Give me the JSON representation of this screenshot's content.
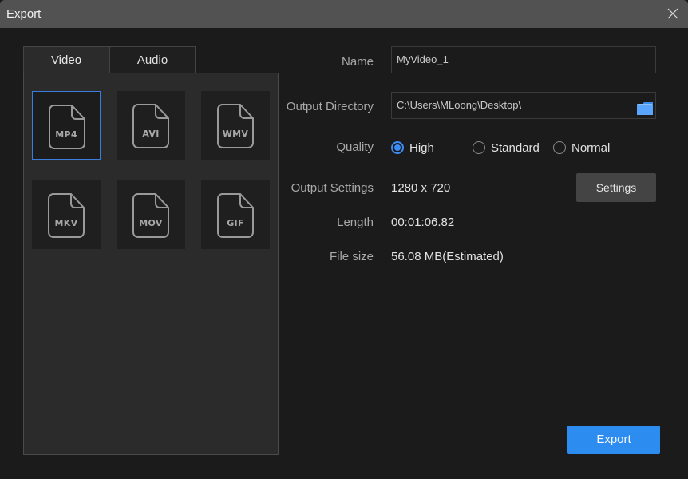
{
  "window": {
    "title": "Export"
  },
  "tabs": [
    {
      "label": "Video",
      "active": true
    },
    {
      "label": "Audio",
      "active": false
    }
  ],
  "formats": [
    {
      "label": "MP4",
      "selected": true
    },
    {
      "label": "AVI",
      "selected": false
    },
    {
      "label": "WMV",
      "selected": false
    },
    {
      "label": "MKV",
      "selected": false
    },
    {
      "label": "MOV",
      "selected": false
    },
    {
      "label": "GIF",
      "selected": false
    }
  ],
  "form": {
    "name_label": "Name",
    "name_value": "MyVideo_1",
    "directory_label": "Output Directory",
    "directory_value": "C:\\Users\\MLoong\\Desktop\\",
    "quality_label": "Quality",
    "quality_options": [
      {
        "label": "High",
        "checked": true
      },
      {
        "label": "Standard",
        "checked": false
      },
      {
        "label": "Normal",
        "checked": false
      }
    ],
    "output_settings_label": "Output Settings",
    "output_settings_value": "1280 x 720",
    "settings_button": "Settings",
    "length_label": "Length",
    "length_value": "00:01:06.82",
    "filesize_label": "File size",
    "filesize_value": "56.08 MB(Estimated)"
  },
  "export_button": "Export",
  "colors": {
    "accent": "#2d8cf0",
    "selection_border": "#3b7ddd",
    "titlebar": "#525252"
  }
}
